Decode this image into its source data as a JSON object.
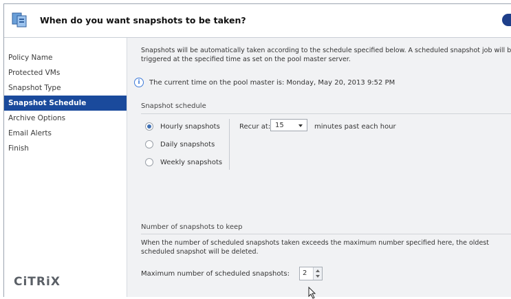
{
  "header": {
    "title": "When do you want snapshots to be taken?"
  },
  "sidebar": {
    "items": [
      {
        "label": "Policy Name",
        "active": false
      },
      {
        "label": "Protected VMs",
        "active": false
      },
      {
        "label": "Snapshot Type",
        "active": false
      },
      {
        "label": "Snapshot Schedule",
        "active": true
      },
      {
        "label": "Archive Options",
        "active": false
      },
      {
        "label": "Email Alerts",
        "active": false
      },
      {
        "label": "Finish",
        "active": false
      }
    ],
    "logo": "CiTRiX"
  },
  "main": {
    "intro": "Snapshots will be automatically taken according to the schedule specified below. A scheduled snapshot job will be triggered at the specified time as set on the pool master server.",
    "info": "The current time on the pool master is: Monday, May 20, 2013 9:52 PM",
    "schedule": {
      "label": "Snapshot schedule",
      "options": [
        {
          "label": "Hourly snapshots",
          "checked": true
        },
        {
          "label": "Daily snapshots",
          "checked": false
        },
        {
          "label": "Weekly snapshots",
          "checked": false
        }
      ],
      "recur_label": "Recur at:",
      "recur_value": "15",
      "recur_suffix": "minutes past each hour"
    },
    "keep": {
      "label": "Number of snapshots to keep",
      "description": "When the number of scheduled snapshots taken exceeds the maximum number specified here, the oldest scheduled snapshot will be deleted.",
      "max_label": "Maximum number of scheduled snapshots:",
      "max_value": "2"
    }
  },
  "colors": {
    "active_nav": "#1a4a9c",
    "panel_bg": "#f1f2f4",
    "info_blue": "#3d7ad8"
  },
  "icons": {
    "header": "snapshot-wizard-icon",
    "info": "info-icon",
    "help": "help-icon"
  }
}
